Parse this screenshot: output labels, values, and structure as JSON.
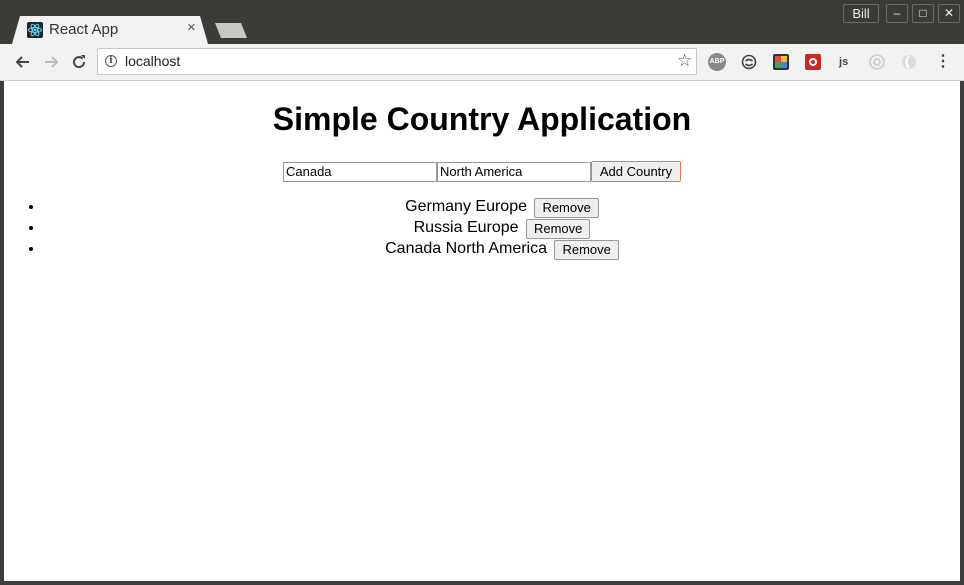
{
  "browser": {
    "user": "Bill",
    "tab": {
      "title": "React App",
      "close": "×"
    },
    "address": {
      "url": "localhost"
    },
    "window_controls": {
      "minimize": "–",
      "maximize": "□",
      "close": "✕"
    }
  },
  "app": {
    "title": "Simple Country Application",
    "form": {
      "country_value": "Canada",
      "continent_value": "North America",
      "add_label": "Add Country"
    },
    "countries": [
      {
        "name": "Germany",
        "continent": "Europe",
        "remove_label": "Remove"
      },
      {
        "name": "Russia",
        "continent": "Europe",
        "remove_label": "Remove"
      },
      {
        "name": "Canada",
        "continent": "North America",
        "remove_label": "Remove"
      }
    ]
  },
  "icons": {
    "tab_favicon": "react-logo-icon",
    "back": "arrow-left-icon",
    "forward": "arrow-right-icon",
    "reload": "reload-icon",
    "info": "info-icon",
    "bookmark": "star-icon",
    "extensions": [
      "adblock-icon",
      "sync-icon",
      "color-picker-icon",
      "extension-red-icon",
      "js-icon",
      "extension-gray-icon",
      "extension-gray-2-icon"
    ]
  },
  "colors": {
    "add_button_border": "#e07a53",
    "react_logo": "#61dafb"
  }
}
